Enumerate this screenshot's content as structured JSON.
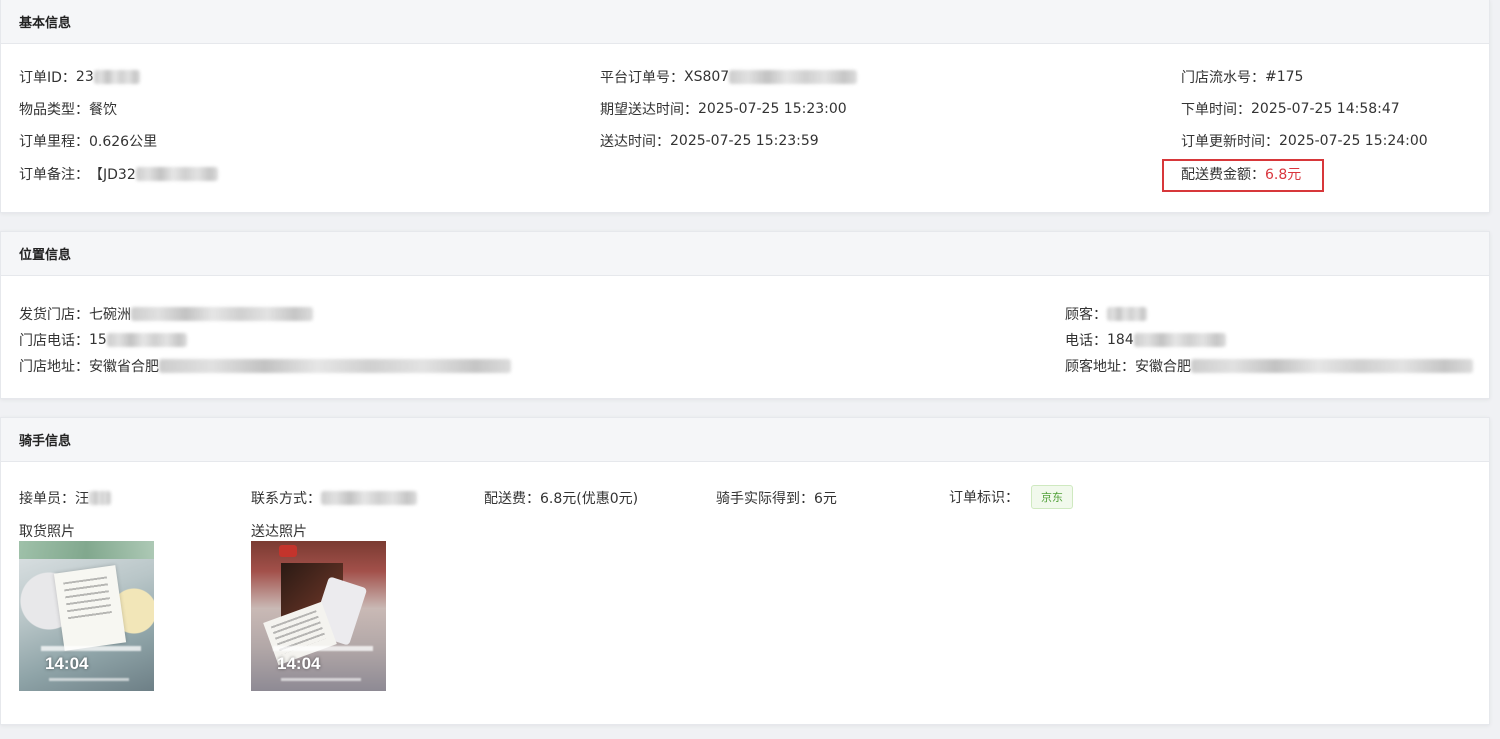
{
  "basic": {
    "header": "基本信息",
    "order_id_label": "订单ID：",
    "order_id_value": "23",
    "platform_order_label": "平台订单号：",
    "platform_order_value": "XS807",
    "store_serial_label": "门店流水号：",
    "store_serial_value": "#175",
    "item_type_label": "物品类型：",
    "item_type_value": "餐饮",
    "expected_time_label": "期望送达时间：",
    "expected_time_value": "2025-07-25 15:23:00",
    "order_time_label": "下单时间：",
    "order_time_value": "2025-07-25 14:58:47",
    "distance_label": "订单里程：",
    "distance_value": "0.626公里",
    "delivered_time_label": "送达时间：",
    "delivered_time_value": "2025-07-25 15:23:59",
    "updated_time_label": "订单更新时间：",
    "updated_time_value": "2025-07-25 15:24:00",
    "remark_label": "订单备注：",
    "remark_value": "【JD32",
    "delivery_fee_label": "配送费金额：",
    "delivery_fee_value": "6.8元",
    "highlight_color": "#d7373a"
  },
  "location": {
    "header": "位置信息",
    "ship_store_label": "发货门店：",
    "ship_store_value": "七碗洲",
    "store_phone_label": "门店电话：",
    "store_phone_value": "15",
    "store_address_label": "门店地址：",
    "store_address_value": "安徽省合肥",
    "customer_label": "顾客：",
    "phone_label": "电话：",
    "phone_value": "184",
    "customer_address_label": "顾客地址：",
    "customer_address_value": "安徽合肥"
  },
  "rider": {
    "header": "骑手信息",
    "receiver_label": "接单员：",
    "receiver_value": "汪",
    "contact_label": "联系方式：",
    "delivery_fee_label": "配送费：",
    "delivery_fee_value": "6.8元(优惠0元)",
    "actual_earn_label": "骑手实际得到：",
    "actual_earn_value": "6元",
    "order_tag_label": "订单标识：",
    "order_tag_value": "京东",
    "pickup_photo_label": "取货照片",
    "delivery_photo_label": "送达照片",
    "pickup_photo_time": "14:04",
    "delivery_photo_time": "14:04"
  }
}
